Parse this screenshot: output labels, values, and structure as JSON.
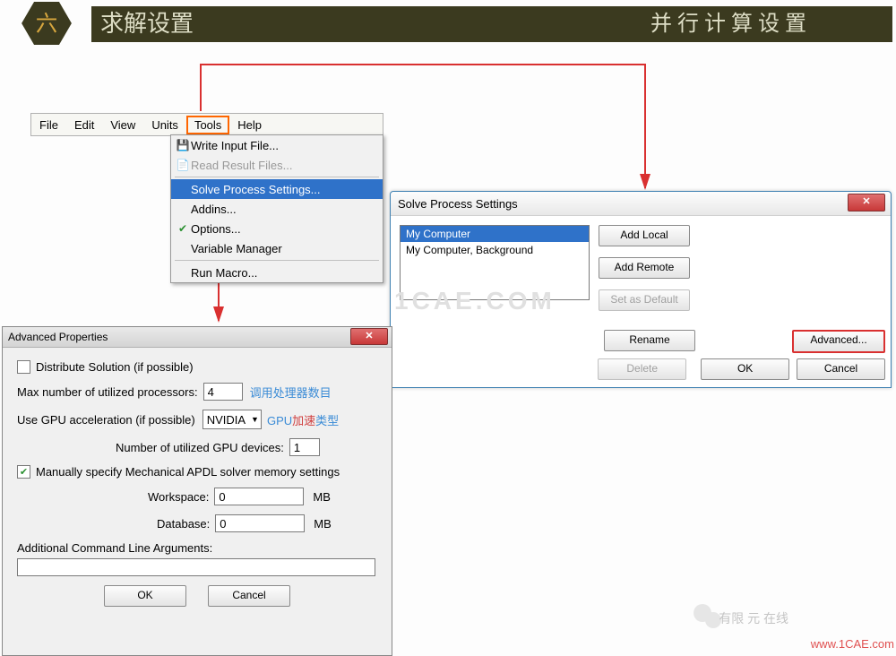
{
  "header": {
    "hex": "六",
    "title_left": "求解设置",
    "title_right": "并行计算设置"
  },
  "menubar": {
    "items": [
      "File",
      "Edit",
      "View",
      "Units",
      "Tools",
      "Help"
    ],
    "highlight": "Tools"
  },
  "tools_menu": {
    "items": [
      {
        "icon": "save",
        "label": "Write Input File..."
      },
      {
        "icon": "read",
        "label": "Read Result Files...",
        "disabled": true
      },
      {
        "sep": true
      },
      {
        "label": "Solve Process Settings...",
        "selected": true
      },
      {
        "label": "Addins..."
      },
      {
        "icon": "check",
        "label": "Options..."
      },
      {
        "label": "Variable Manager"
      },
      {
        "sep": true
      },
      {
        "label": "Run Macro..."
      }
    ]
  },
  "sps": {
    "title": "Solve Process Settings",
    "list": [
      "My Computer",
      "My Computer, Background"
    ],
    "selected": 0,
    "buttons": {
      "add_local": "Add Local",
      "add_remote": "Add Remote",
      "set_default": "Set as Default",
      "rename": "Rename",
      "advanced": "Advanced...",
      "delete": "Delete",
      "ok": "OK",
      "cancel": "Cancel"
    }
  },
  "adv": {
    "title": "Advanced Properties",
    "distribute": "Distribute Solution (if possible)",
    "max_proc_label": "Max number of utilized processors:",
    "max_proc_value": "4",
    "max_proc_hint": "调用处理器数目",
    "gpu_label": "Use GPU acceleration (if possible)",
    "gpu_value": "NVIDIA",
    "gpu_hint": "GPU加速类型",
    "gpu_num_label": "Number of utilized GPU devices:",
    "gpu_num_value": "1",
    "mem_cb": "Manually specify Mechanical APDL solver memory settings",
    "ws_label": "Workspace:",
    "ws_value": "0",
    "db_label": "Database:",
    "db_value": "0",
    "mb": "MB",
    "addl": "Additional Command Line Arguments:",
    "ok": "OK",
    "cancel": "Cancel"
  },
  "watermark": {
    "t1": "有限",
    "t2": "元",
    "t3": "在线",
    "url": "www.1CAE.com"
  },
  "wm_bg": "1CAE.COM"
}
